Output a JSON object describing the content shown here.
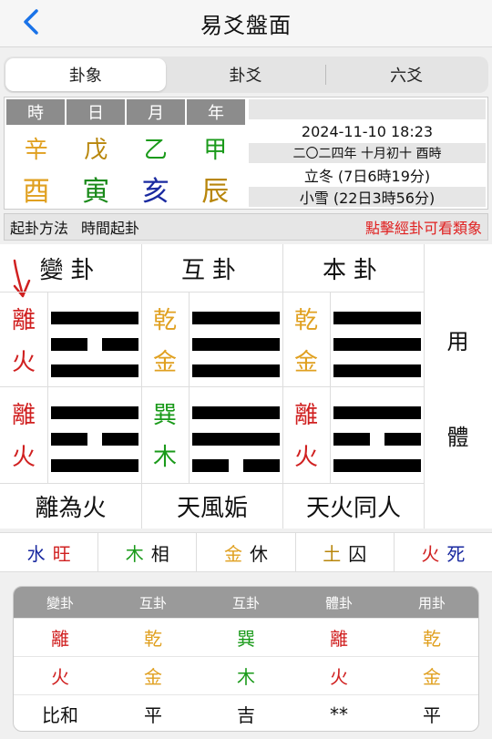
{
  "header": {
    "title": "易爻盤面"
  },
  "tabs": [
    {
      "label": "卦象",
      "active": true
    },
    {
      "label": "卦爻",
      "active": false
    },
    {
      "label": "六爻",
      "active": false
    }
  ],
  "pillars": {
    "headers": [
      "時",
      "日",
      "月",
      "年"
    ],
    "stems": [
      {
        "char": "辛",
        "color": "#e0a020"
      },
      {
        "char": "戊",
        "color": "#b8860b"
      },
      {
        "char": "乙",
        "color": "#1a9a1a"
      },
      {
        "char": "甲",
        "color": "#1a9a1a"
      }
    ],
    "branches": [
      {
        "char": "酉",
        "color": "#e0a020"
      },
      {
        "char": "寅",
        "color": "#1a8a1a"
      },
      {
        "char": "亥",
        "color": "#1a2aa0"
      },
      {
        "char": "辰",
        "color": "#b8860b"
      }
    ]
  },
  "info": {
    "datetime": "2024-11-10 18:23",
    "lunar": "二〇二四年 十月初十 酉時",
    "solar_term_1": "立冬 (7日6時19分)",
    "solar_term_2": "小雪 (22日3時56分)"
  },
  "method": {
    "label": "起卦方法",
    "value": "時間起卦",
    "hint": "點擊經卦可看類象"
  },
  "hexagrams": {
    "headers": [
      "變卦",
      "互卦",
      "本卦"
    ],
    "columns": [
      {
        "upper": {
          "chars": [
            "離",
            "火"
          ],
          "colors": [
            "#d02020",
            "#d02020"
          ],
          "lines": [
            1,
            0,
            1
          ]
        },
        "lower": {
          "chars": [
            "離",
            "火"
          ],
          "colors": [
            "#d02020",
            "#d02020"
          ],
          "lines": [
            1,
            0,
            1
          ]
        },
        "name": "離為火"
      },
      {
        "upper": {
          "chars": [
            "乾",
            "金"
          ],
          "colors": [
            "#e0a020",
            "#e0a020"
          ],
          "lines": [
            1,
            1,
            1
          ]
        },
        "lower": {
          "chars": [
            "巽",
            "木"
          ],
          "colors": [
            "#1a9a1a",
            "#1a9a1a"
          ],
          "lines": [
            1,
            1,
            0
          ]
        },
        "name": "天風姤"
      },
      {
        "upper": {
          "chars": [
            "乾",
            "金"
          ],
          "colors": [
            "#e0a020",
            "#e0a020"
          ],
          "lines": [
            1,
            1,
            1
          ]
        },
        "lower": {
          "chars": [
            "離",
            "火"
          ],
          "colors": [
            "#d02020",
            "#d02020"
          ],
          "lines": [
            1,
            0,
            1
          ]
        },
        "name": "天火同人"
      }
    ],
    "roles": [
      "用",
      "體"
    ],
    "arrow_color": "#d02020"
  },
  "states": [
    {
      "element": "水",
      "element_color": "#1a2aa0",
      "state": "旺",
      "state_color": "#d02020"
    },
    {
      "element": "木",
      "element_color": "#1a9a1a",
      "state": "相",
      "state_color": "#111111"
    },
    {
      "element": "金",
      "element_color": "#e0a020",
      "state": "休",
      "state_color": "#111111"
    },
    {
      "element": "土",
      "element_color": "#b8860b",
      "state": "囚",
      "state_color": "#111111"
    },
    {
      "element": "火",
      "element_color": "#d02020",
      "state": "死",
      "state_color": "#1a2aa0"
    }
  ],
  "summary": {
    "headers": [
      "變卦",
      "互卦",
      "互卦",
      "體卦",
      "用卦"
    ],
    "rows": [
      [
        {
          "text": "離",
          "color": "#d02020"
        },
        {
          "text": "乾",
          "color": "#e0a020"
        },
        {
          "text": "巽",
          "color": "#1a9a1a"
        },
        {
          "text": "離",
          "color": "#d02020"
        },
        {
          "text": "乾",
          "color": "#e0a020"
        }
      ],
      [
        {
          "text": "火",
          "color": "#d02020"
        },
        {
          "text": "金",
          "color": "#e0a020"
        },
        {
          "text": "木",
          "color": "#1a9a1a"
        },
        {
          "text": "火",
          "color": "#d02020"
        },
        {
          "text": "金",
          "color": "#e0a020"
        }
      ],
      [
        {
          "text": "比和",
          "color": "#111111"
        },
        {
          "text": "平",
          "color": "#111111"
        },
        {
          "text": "吉",
          "color": "#111111"
        },
        {
          "text": "**",
          "color": "#111111"
        },
        {
          "text": "平",
          "color": "#111111"
        }
      ]
    ]
  }
}
